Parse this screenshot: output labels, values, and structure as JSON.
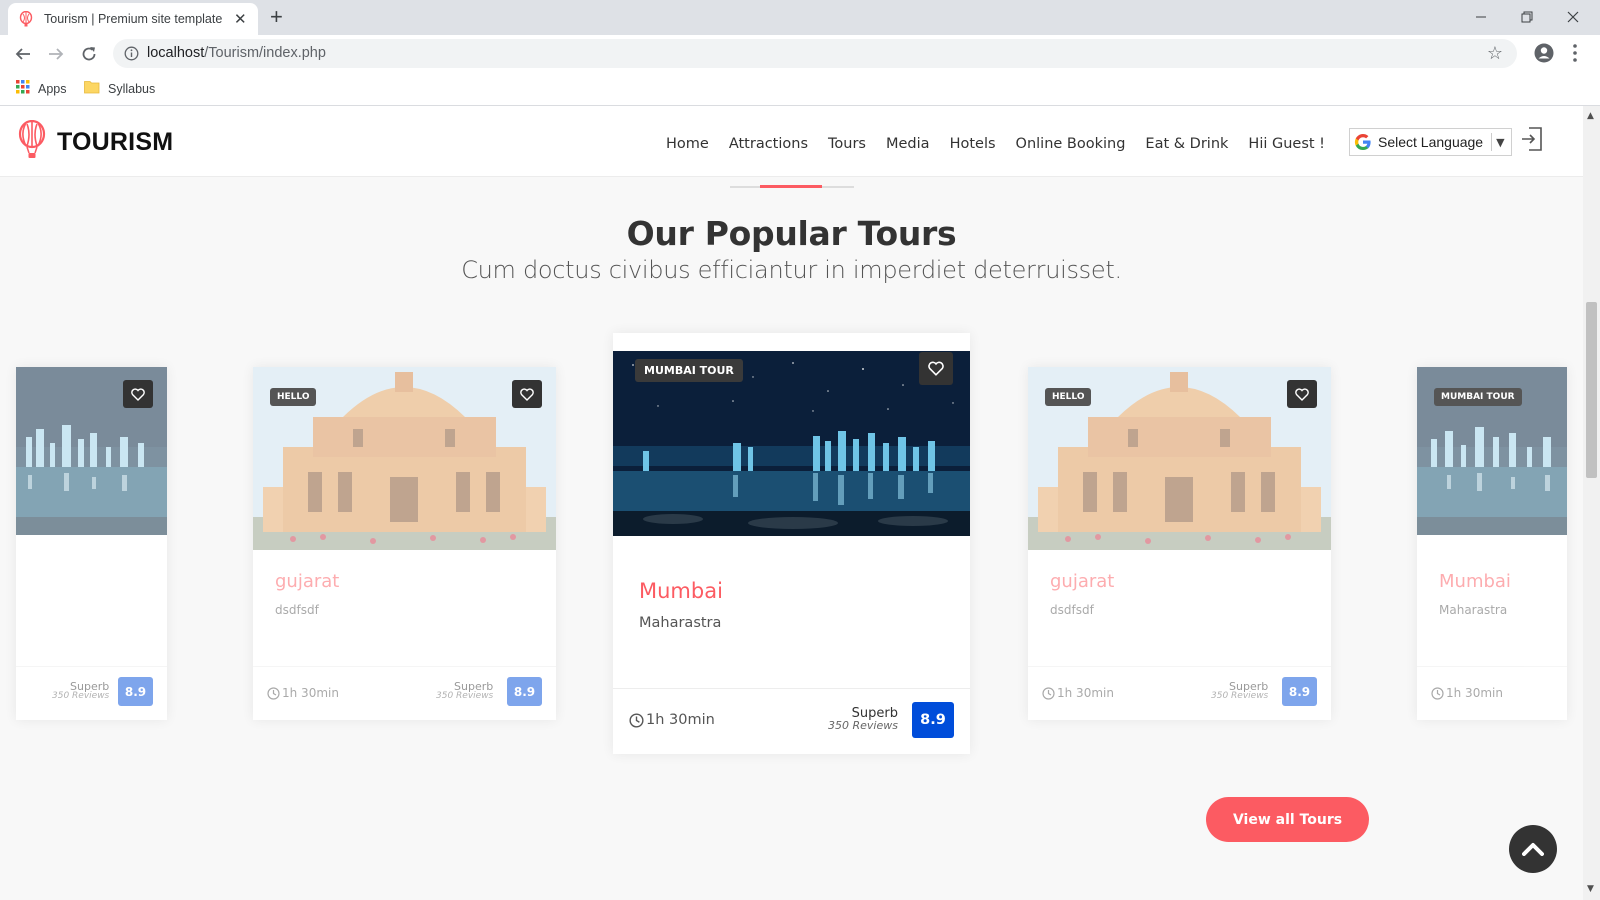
{
  "browser": {
    "tab_title": "Tourism | Premium site template",
    "new_tab": "+",
    "url_host": "localhost",
    "url_path": "/Tourism/index.php",
    "bookmarks": [
      {
        "label": "Apps",
        "icon": "apps-grid-icon"
      },
      {
        "label": "Syllabus",
        "icon": "folder-icon"
      }
    ]
  },
  "header": {
    "logo_text": "TOURISM",
    "logo_icon": "hot-air-balloon-icon",
    "nav": [
      "Home",
      "Attractions",
      "Tours",
      "Media",
      "Hotels",
      "Online Booking",
      "Eat & Drink",
      "Hii Guest !"
    ],
    "language_select": "Select Language",
    "login_icon": "login-icon"
  },
  "section": {
    "title": "Our Popular Tours",
    "subtitle": "Cum doctus civibus efficiantur in imperdiet deterruisset."
  },
  "cards": [
    {
      "badge": "",
      "title": "",
      "desc": "",
      "duration": "",
      "rating_word": "Superb",
      "reviews": "350 Reviews",
      "score": "8.9",
      "image": "city-night"
    },
    {
      "badge": "HELLO",
      "title": "gujarat",
      "desc": "dsdfsdf",
      "duration": "1h 30min",
      "rating_word": "Superb",
      "reviews": "350 Reviews",
      "score": "8.9",
      "image": "temple"
    },
    {
      "badge": "MUMBAI TOUR",
      "title": "Mumbai",
      "desc": "Maharastra",
      "duration": "1h 30min",
      "rating_word": "Superb",
      "reviews": "350 Reviews",
      "score": "8.9",
      "image": "city-night"
    },
    {
      "badge": "HELLO",
      "title": "gujarat",
      "desc": "dsdfsdf",
      "duration": "1h 30min",
      "rating_word": "Superb",
      "reviews": "350 Reviews",
      "score": "8.9",
      "image": "temple"
    },
    {
      "badge": "MUMBAI TOUR",
      "title": "Mumbai",
      "desc": "Maharastra",
      "duration": "1h 30min",
      "rating_word": "",
      "reviews": "",
      "score": "",
      "image": "city-night"
    }
  ],
  "view_all_label": "View all Tours",
  "colors": {
    "accent": "#fc5b62",
    "score_bg": "#004dda",
    "text": "#333333"
  }
}
